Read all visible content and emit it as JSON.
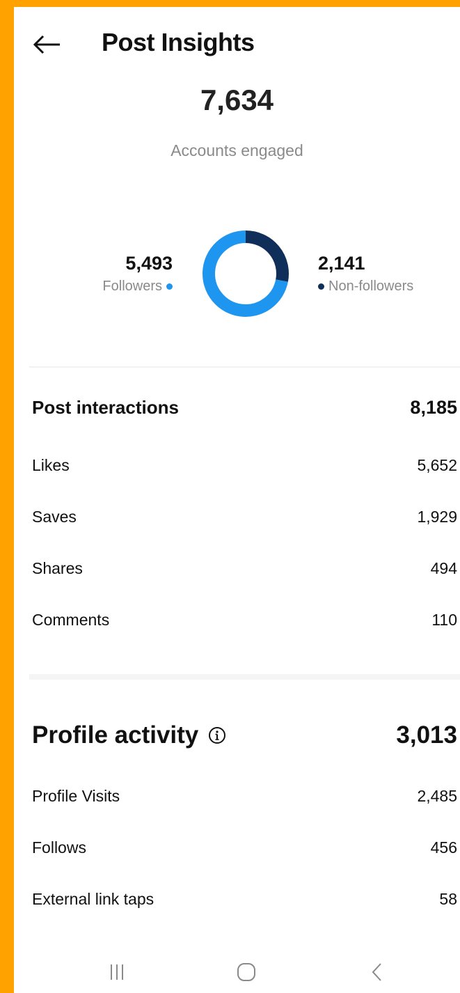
{
  "header": {
    "title": "Post Insights"
  },
  "summary": {
    "accounts_engaged": "7,634",
    "accounts_engaged_label": "Accounts engaged"
  },
  "audience": {
    "followers_value": "5,493",
    "followers_label": "Followers",
    "followers_color": "#1E96F0",
    "non_followers_value": "2,141",
    "non_followers_label": "Non-followers",
    "non_followers_color": "#0F2F5A"
  },
  "chart_data": {
    "type": "pie",
    "categories": [
      "Followers",
      "Non-followers"
    ],
    "values": [
      5493,
      2141
    ],
    "colors": [
      "#1E96F0",
      "#0F2F5A"
    ]
  },
  "post_interactions": {
    "label": "Post interactions",
    "total": "8,185",
    "items": [
      {
        "label": "Likes",
        "value": "5,652"
      },
      {
        "label": "Saves",
        "value": "1,929"
      },
      {
        "label": "Shares",
        "value": "494"
      },
      {
        "label": "Comments",
        "value": "110"
      }
    ]
  },
  "profile_activity": {
    "label": "Profile activity",
    "total": "3,013",
    "items": [
      {
        "label": "Profile Visits",
        "value": "2,485"
      },
      {
        "label": "Follows",
        "value": "456"
      },
      {
        "label": "External link taps",
        "value": "58"
      }
    ]
  },
  "icons": {
    "back": "arrow-left-icon",
    "info": "info-icon",
    "recents": "recents-icon",
    "home": "home-icon",
    "nav_back": "chevron-left-icon"
  }
}
